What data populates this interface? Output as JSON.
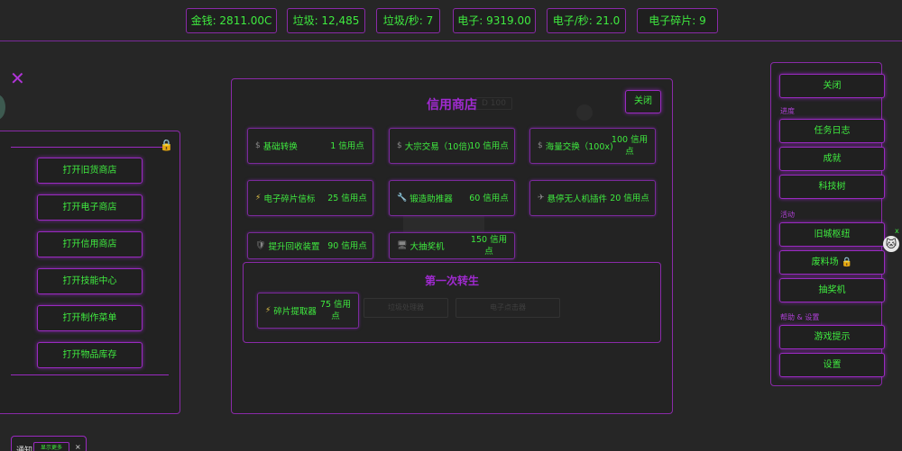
{
  "stats": {
    "money": "金钱: 2811.00C",
    "trash": "垃圾: 12,485",
    "trash_rate": "垃圾/秒: 7",
    "electrons": "电子: 9319.00",
    "electron_rate": "电子/秒: 21.0",
    "electron_shards": "电子碎片:   9"
  },
  "close_symbol": "✕",
  "left_panel": {
    "buttons": [
      "打开旧货商店",
      "打开电子商店",
      "打开信用商店",
      "打开技能中心",
      "打开制作菜单",
      "打开物品库存"
    ],
    "lock_icon": "🔒"
  },
  "shop": {
    "title": "信用商店",
    "close_label": "关闭",
    "ghost_header": "D 100",
    "items": [
      {
        "icon": "$",
        "name": "基础转换",
        "cost": "1 信用点"
      },
      {
        "icon": "$",
        "name": "大宗交易（10倍)",
        "cost": "10 信用点"
      },
      {
        "icon": "$",
        "name": "海量交换（100x)",
        "cost": "100 信用点"
      },
      {
        "icon": "⚡",
        "name": "电子碎片信标",
        "cost": "25 信用点"
      },
      {
        "icon": "🔧",
        "name": "锻造助推器",
        "cost": "60 信用点"
      },
      {
        "icon": "✈",
        "name": "悬停无人机插件",
        "cost": "20 信用点"
      },
      {
        "icon": "🛡",
        "name": "提升回收装置",
        "cost": "90 信用点"
      },
      {
        "icon": "🖥",
        "name": "大抽奖机",
        "cost": "150 信用点"
      }
    ],
    "rebirth": {
      "title": "第一次转生",
      "item": {
        "icon": "⚡",
        "name": "碎片提取器",
        "cost": "75 信用点"
      },
      "disabled_1": "垃圾处理器",
      "disabled_2": "电子点击器"
    }
  },
  "right_panel": {
    "close_label": "关闭",
    "sections": {
      "progress": "进度",
      "activities": "活动",
      "help": "帮助 & 设置"
    },
    "buttons": {
      "task_log": "任务日志",
      "achievements": "成就",
      "tech_tree": "科技树",
      "hub": "旧城枢纽",
      "junkyard": "废料场 🔒",
      "lottery": "抽奖机",
      "tips": "游戏提示",
      "settings": "设置"
    }
  },
  "side_mascot": {
    "icon": "🐱",
    "close": "x"
  },
  "notification": {
    "label": "通知",
    "more": "显示更多",
    "close": "×"
  }
}
